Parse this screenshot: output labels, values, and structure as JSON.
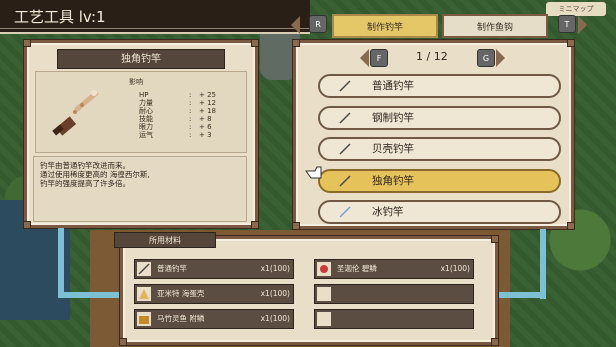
{
  "title_bar": {
    "title": "工艺工具 lv:1"
  },
  "top_right": {
    "badge": "ミニマップ"
  },
  "tabs": {
    "left_key": "R",
    "right_key": "T",
    "items": [
      {
        "label": "制作钓竿",
        "active": true
      },
      {
        "label": "制作鱼钩",
        "active": false
      }
    ]
  },
  "pager": {
    "left_key": "F",
    "right_key": "G",
    "text": "1 / 12"
  },
  "rod_list": [
    {
      "label": "普通钓竿",
      "selected": false,
      "icon": "fishing-rod-icon"
    },
    {
      "label": "钢制钓竿",
      "selected": false,
      "icon": "fishing-rod-icon"
    },
    {
      "label": "贝壳钓竿",
      "selected": false,
      "icon": "fishing-rod-icon"
    },
    {
      "label": "独角钓竿",
      "selected": true,
      "icon": "fishing-rod-icon"
    },
    {
      "label": "冰钓竿",
      "selected": false,
      "icon": "fishing-rod-icon"
    }
  ],
  "detail": {
    "header": "独角钓竿",
    "effect_title": "影响",
    "stats": [
      {
        "name": "HP",
        "value": "+ 25"
      },
      {
        "name": "力量",
        "value": "+ 12"
      },
      {
        "name": "耐心",
        "value": "+ 18"
      },
      {
        "name": "技能",
        "value": "+ 8"
      },
      {
        "name": "眼力",
        "value": "+ 6"
      },
      {
        "name": "运气",
        "value": "+ 3"
      }
    ],
    "description": [
      "钓竿由普通钓竿改进而来。",
      "通过使用稀度更高的 海徨西尔斯,",
      "钓竿的强度提高了许多倍。"
    ]
  },
  "materials": {
    "header": "所用材料",
    "items": [
      {
        "name": "普通钓竿",
        "count": "x1(100)",
        "icon": "fishing-rod-icon"
      },
      {
        "name": "亚米特 海蛋壳",
        "count": "x1(100)",
        "icon": "shell-icon"
      },
      {
        "name": "马竹灵鱼 附鳞",
        "count": "x1(100)",
        "icon": "chest-icon"
      },
      {
        "name": "圣迦伦 碧鳞",
        "count": "x1(100)",
        "icon": "gem-icon"
      },
      {
        "name": "",
        "count": "",
        "icon": ""
      },
      {
        "name": "",
        "count": "",
        "icon": ""
      }
    ]
  },
  "colors": {
    "accent": "#e6c35a",
    "panel": "#e9dfc9",
    "dark": "#55463b",
    "connector": "#7ec0d3"
  }
}
